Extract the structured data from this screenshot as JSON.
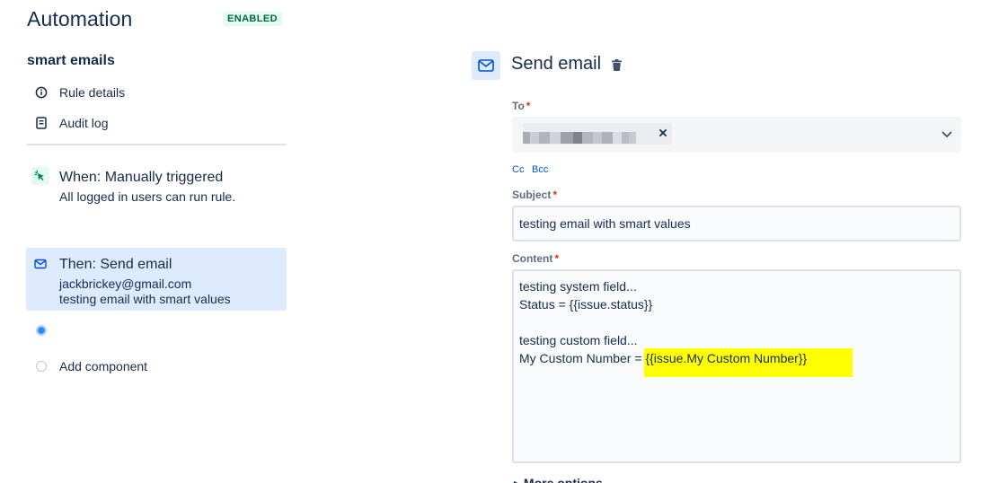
{
  "header": {
    "title": "Automation",
    "status_badge": "ENABLED"
  },
  "rule": {
    "name": "smart emails"
  },
  "nav": [
    {
      "label": "Rule details",
      "icon": "info-icon"
    },
    {
      "label": "Audit log",
      "icon": "document-icon"
    }
  ],
  "components": {
    "trigger": {
      "title": "When: Manually triggered",
      "subtitle": "All logged in users can run rule.",
      "icon": "cursor-click-icon"
    },
    "action": {
      "title": "Then: Send email",
      "line1": "jackbrickey@gmail.com",
      "line2": "testing email with smart values",
      "icon": "mail-icon"
    },
    "add_label": "Add component"
  },
  "panel": {
    "title": "Send email",
    "to_label": "To",
    "cc_label": "Cc",
    "bcc_label": "Bcc",
    "subject_label": "Subject",
    "subject_value": "testing email with smart values",
    "content_label": "Content",
    "content_lines": [
      "testing system field...",
      "Status = {{issue.status}}",
      "",
      "testing custom field...",
      "My Custom Number = "
    ],
    "content_highlight": "{{issue.My Custom Number}}",
    "more_options": "More options",
    "required_mark": "*"
  },
  "colors": {
    "accent": "#0052cc",
    "selected_bg": "#deebff",
    "badge_bg": "#e3fcef",
    "badge_text": "#006644",
    "highlight": "#ffff00",
    "required": "#de350b"
  }
}
